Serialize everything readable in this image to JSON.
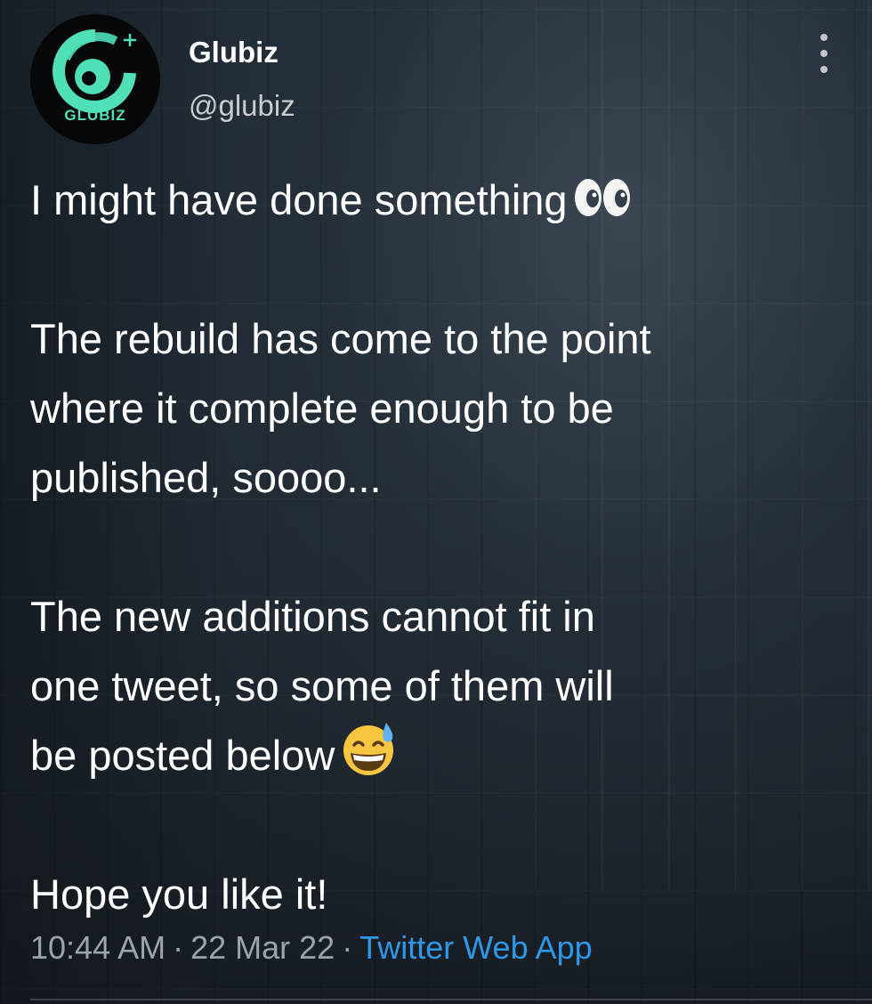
{
  "author": {
    "display_name": "Glubiz",
    "handle": "@glubiz",
    "avatar_text": "GLUBIZ"
  },
  "tweet": {
    "lines": [
      "I might have done something",
      "The rebuild has come to the point",
      "where it complete enough to be",
      "published, soooo...",
      "The new additions cannot fit in",
      "one tweet, so some of them will",
      "be posted below",
      "Hope you like it!"
    ],
    "emojis": [
      "eyes-icon",
      "grinning-sweat-icon"
    ]
  },
  "meta": {
    "time": "10:44 AM",
    "separator": "·",
    "date": "22 Mar 22",
    "source": "Twitter Web App",
    "source_color": "#2e98e8"
  },
  "colors": {
    "text": "#ffffff",
    "muted": "#9ba3ab",
    "accent": "#2e98e8",
    "avatar_accent": "#4fe0b8"
  }
}
